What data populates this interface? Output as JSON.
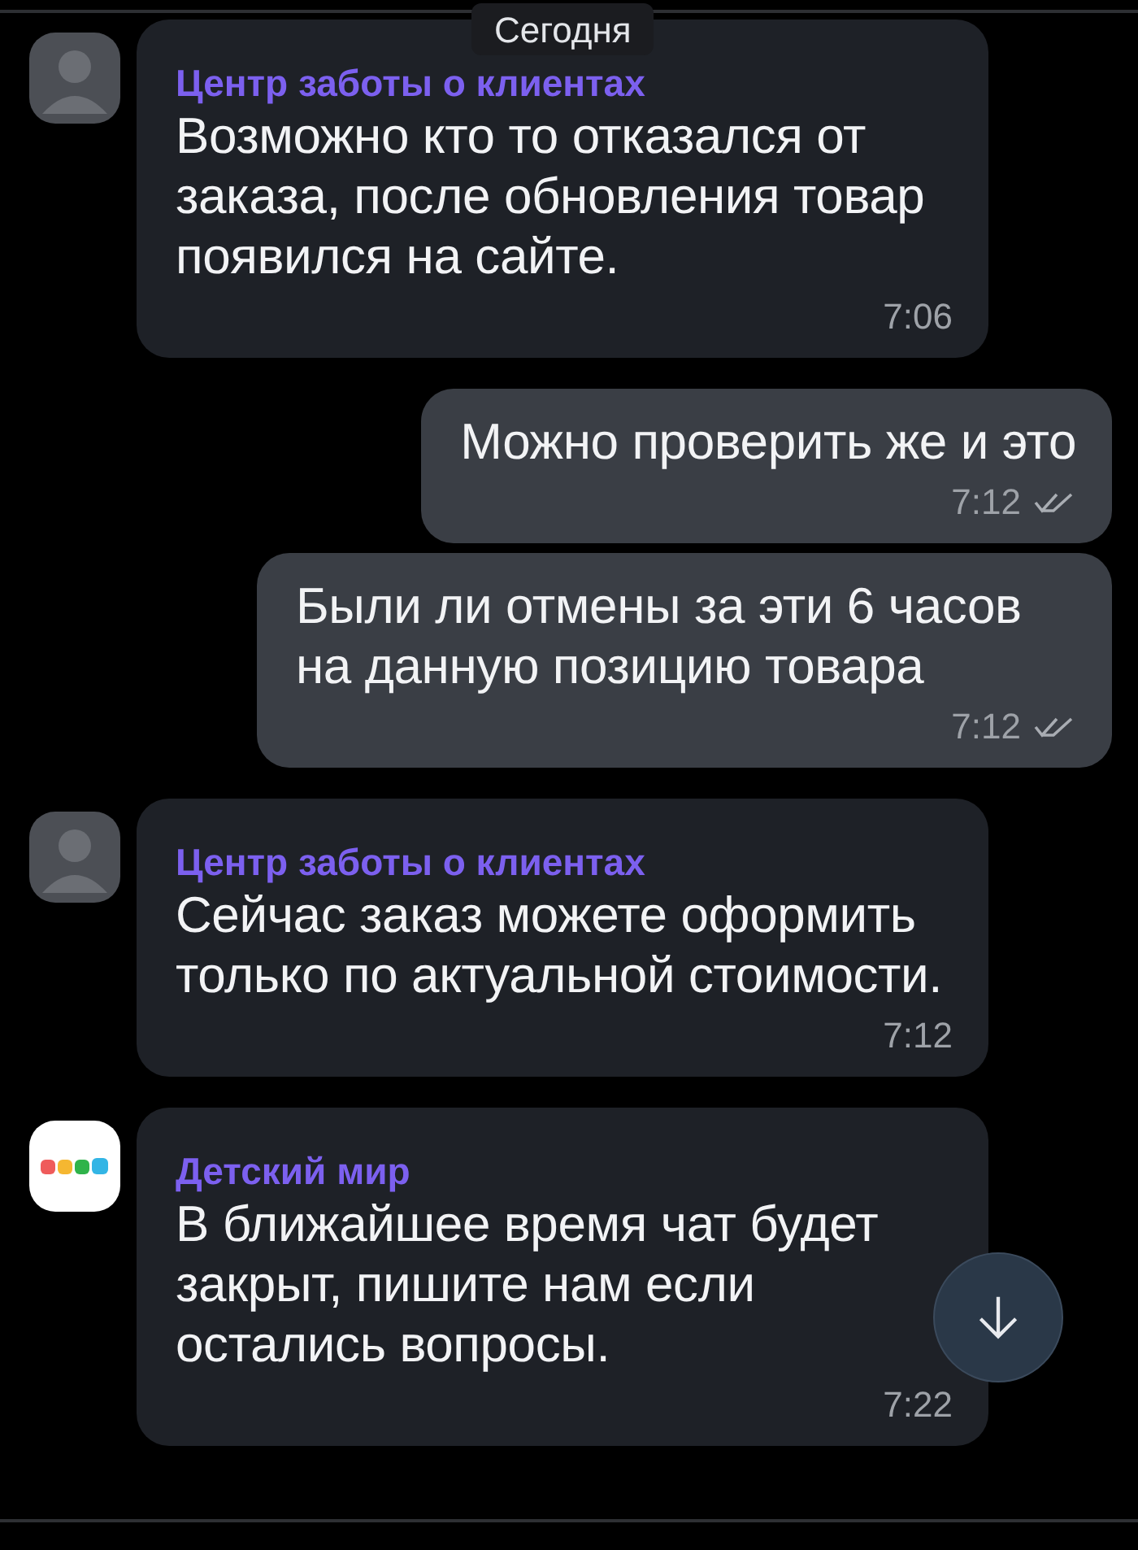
{
  "date_chip": "Сегодня",
  "messages": [
    {
      "kind": "incoming",
      "avatar": {
        "kind": "person"
      },
      "sender": "Центр заботы о клиентах",
      "text": "Возможно кто то отказался от заказа, после обновления товар появился на сайте.",
      "time": "7:06"
    },
    {
      "kind": "outgoing",
      "text": "Можно проверить же и это",
      "time": "7:12",
      "read": true
    },
    {
      "kind": "outgoing",
      "text": "Были ли отмены за эти 6 часов на данную позицию товара",
      "time": "7:12",
      "read": true
    },
    {
      "kind": "incoming",
      "avatar": {
        "kind": "person"
      },
      "sender": "Центр заботы о клиентах",
      "text": "Сейчас заказ можете оформить только по актуальной стоимости.",
      "time": "7:12"
    },
    {
      "kind": "incoming",
      "avatar": {
        "kind": "logo"
      },
      "sender": "Детский мир",
      "text": "В ближайшее время чат будет закрыт, пишите нам если остались вопросы.",
      "time": "7:22"
    }
  ]
}
